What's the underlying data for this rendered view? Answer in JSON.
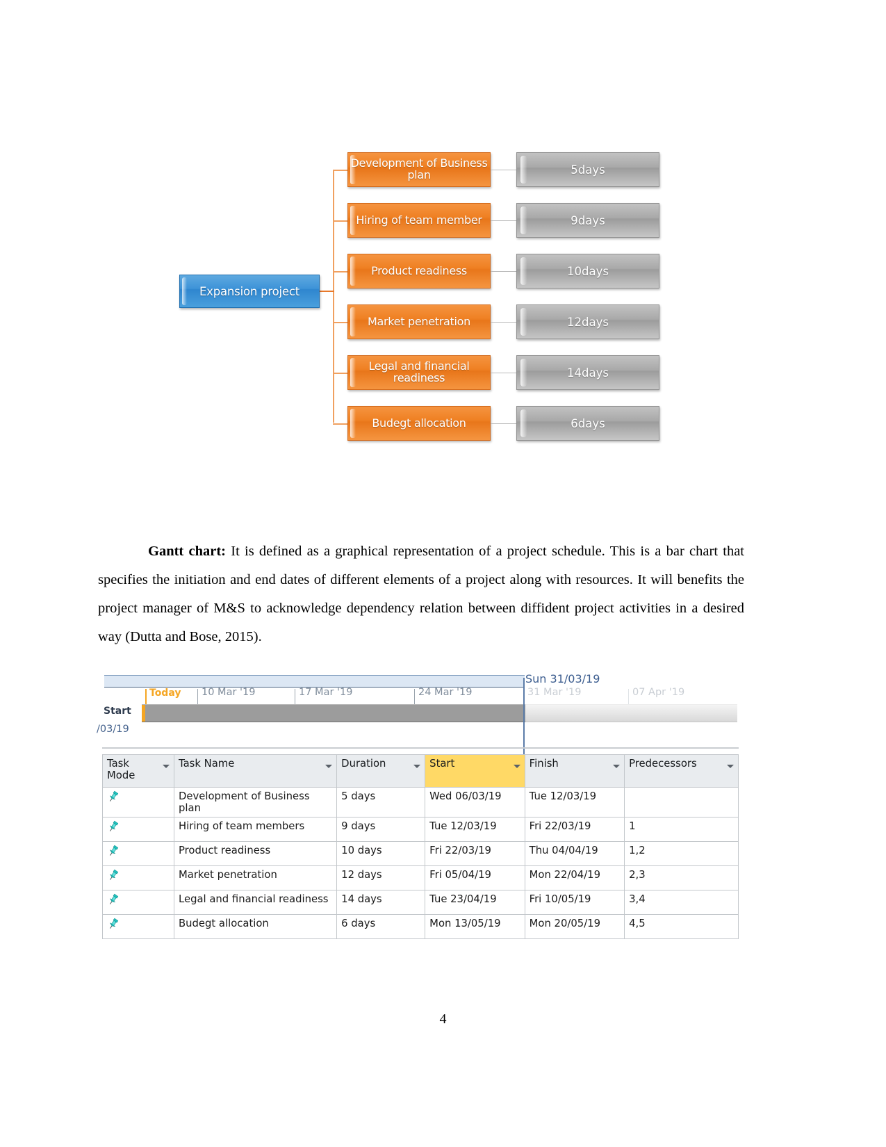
{
  "document": {
    "page_number": "4"
  },
  "wbs": {
    "root_label": "Expansion project",
    "tasks": [
      {
        "name": "Development of Business plan",
        "duration": "5days"
      },
      {
        "name": "Hiring of team member",
        "duration": "9days"
      },
      {
        "name": "Product readiness",
        "duration": "10days"
      },
      {
        "name": "Market penetration",
        "duration": "12days"
      },
      {
        "name": "Legal and financial readiness",
        "duration": "14days"
      },
      {
        "name": "Budegt allocation",
        "duration": "6days"
      }
    ],
    "colors": {
      "root": "#3d93d8",
      "task": "#ef8023",
      "duration": "#a9a9a9",
      "connector": "#f0a060"
    }
  },
  "paragraph": {
    "heading": "Gantt chart:",
    "body": " It is defined as a graphical representation of a project schedule. This is a bar chart that specifies the initiation and end dates of different elements of a project along with resources. It will benefits the project manager of M&S to acknowledge dependency relation between diffident project activities in a desired way (Dutta and Bose,  2015)."
  },
  "gantt": {
    "timeline": {
      "today_label": "Today",
      "start_label": "Start",
      "start_date": "/03/19",
      "finish_label": "Sun 31/03/19",
      "ticks": [
        {
          "label": "10 Mar '19",
          "dim": false
        },
        {
          "label": "17 Mar '19",
          "dim": false
        },
        {
          "label": "24 Mar '19",
          "dim": false
        },
        {
          "label": "31 Mar '19",
          "dim": true
        },
        {
          "label": "07 Apr '19",
          "dim": true
        }
      ]
    },
    "table": {
      "columns": [
        {
          "label": "Task Mode",
          "highlighted": false
        },
        {
          "label": "Task Name",
          "highlighted": false
        },
        {
          "label": "Duration",
          "highlighted": false
        },
        {
          "label": "Start",
          "highlighted": true
        },
        {
          "label": "Finish",
          "highlighted": false
        },
        {
          "label": "Predecessors",
          "highlighted": false
        }
      ],
      "rows": [
        {
          "mode": "pin-icon",
          "name": "Development of Business plan",
          "duration": "5 days",
          "start": "Wed 06/03/19",
          "finish": "Tue 12/03/19",
          "predecessors": ""
        },
        {
          "mode": "pin-icon",
          "name": "Hiring of team members",
          "duration": "9 days",
          "start": "Tue 12/03/19",
          "finish": "Fri 22/03/19",
          "predecessors": "1"
        },
        {
          "mode": "pin-icon",
          "name": "Product readiness",
          "duration": "10 days",
          "start": "Fri 22/03/19",
          "finish": "Thu 04/04/19",
          "predecessors": "1,2"
        },
        {
          "mode": "pin-icon",
          "name": "Market penetration",
          "duration": "12 days",
          "start": "Fri 05/04/19",
          "finish": "Mon 22/04/19",
          "predecessors": "2,3"
        },
        {
          "mode": "pin-icon",
          "name": "Legal and financial readiness",
          "duration": "14 days",
          "start": "Tue 23/04/19",
          "finish": "Fri 10/05/19",
          "predecessors": "3,4"
        },
        {
          "mode": "pin-icon",
          "name": "Budegt allocation",
          "duration": "6 days",
          "start": "Mon 13/05/19",
          "finish": "Mon 20/05/19",
          "predecessors": "4,5"
        }
      ]
    }
  }
}
